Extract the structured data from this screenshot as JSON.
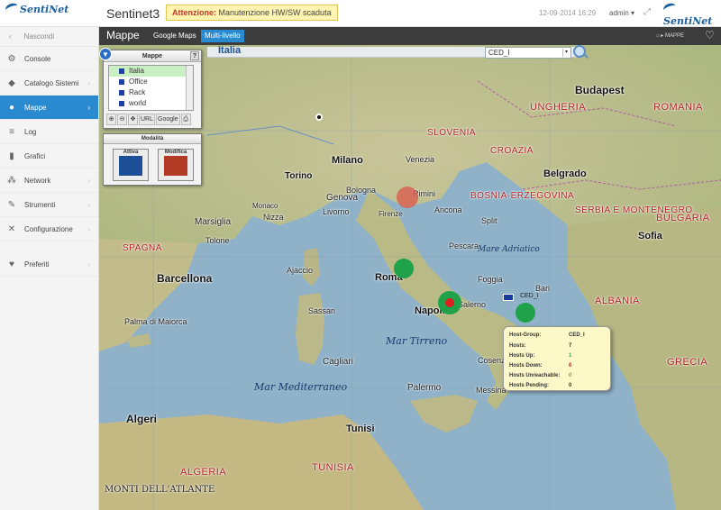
{
  "header": {
    "logo_text": "SentiNet",
    "app_title": "Sentinet3",
    "alert_prefix": "Attenzione:",
    "alert_text": "Manutenzione HW/SW scaduta",
    "datetime": "12-09-2014 16:29",
    "user": "admin",
    "user_caret": "▾",
    "expand_icon": "⤢"
  },
  "sidebar": {
    "hide_label": "Nascondi",
    "items": [
      {
        "label": "Console",
        "icon": "⚙",
        "chevron": ""
      },
      {
        "label": "Catalogo Sistemi",
        "icon": "◆",
        "chevron": "›"
      },
      {
        "label": "Mappe",
        "icon": "●",
        "chevron": "›"
      },
      {
        "label": "Log",
        "icon": "≡",
        "chevron": ""
      },
      {
        "label": "Grafici",
        "icon": "▮",
        "chevron": ""
      },
      {
        "label": "Network",
        "icon": "⁂",
        "chevron": "›"
      },
      {
        "label": "Strumenti",
        "icon": "✎",
        "chevron": "›"
      },
      {
        "label": "Configurazione",
        "icon": "✕",
        "chevron": "›"
      },
      {
        "label": "Preferiti",
        "icon": "♥",
        "chevron": "›"
      }
    ]
  },
  "content": {
    "title": "Mappe",
    "tabs": [
      "Google Maps",
      "Multi-livello"
    ],
    "breadcrumb": "⌂ ▸ MAPPE",
    "favorite_icon": "♡"
  },
  "map": {
    "name": "Italia",
    "select_value": "CED_I",
    "select_caret": "▾",
    "labels": [
      "Budapest",
      "UNGHERIA",
      "ROMANIA",
      "SLOVENIA",
      "CROAZIA",
      "Belgrado",
      "BOSNIA-ERZEGOVINA",
      "SERBIA E MONTENEGRO",
      "BULGARIA",
      "Sofia",
      "Milano",
      "Torino",
      "Genova",
      "Firenze",
      "Roma",
      "Napoli",
      "Bari",
      "Palermo",
      "Cagliari",
      "Barcellona",
      "SPAGNA",
      "Marsiglia",
      "Tolone",
      "Nizza",
      "Monaco",
      "Ajaccio",
      "Sassari",
      "Algeri",
      "ALGERIA",
      "Tunisi",
      "TUNISIA",
      "ALBANIA",
      "GRECIA",
      "Mar Tirreno",
      "Mar Mediterraneo",
      "Mare Adriatico",
      "Venezia",
      "Bologna",
      "Rimini",
      "Ancona",
      "Pescara",
      "Livorno",
      "Salerno",
      "Foggia",
      "Split",
      "Palma di Maiorca",
      "Cosenza",
      "Messina",
      "MONTI DELL'ATLANTE"
    ],
    "node_label": "CED_I"
  },
  "maps_panel": {
    "title": "Mappe",
    "help": "?",
    "items": [
      "Italia",
      "Office",
      "Rack",
      "world"
    ],
    "tools": [
      "⊕",
      "⊖",
      "✥",
      "URL",
      "Google",
      "⎙"
    ]
  },
  "modality": {
    "title": "Modalità",
    "activate": "Attiva",
    "edit": "Modifica"
  },
  "tooltip": {
    "rows": [
      {
        "label": "Host-Group:",
        "value": "CED_I",
        "color": "#333333"
      },
      {
        "label": "Hosts:",
        "value": "7",
        "color": "#333333"
      },
      {
        "label": "Hosts Up:",
        "value": "1",
        "color": "#2e9e3a"
      },
      {
        "label": "Hosts Down:",
        "value": "6",
        "color": "#e02020"
      },
      {
        "label": "Hosts Unreachable:",
        "value": "0",
        "color": "#e07a00"
      },
      {
        "label": "Hosts Pending:",
        "value": "0",
        "color": "#333333"
      }
    ]
  },
  "colors": {
    "accent": "#2a8ad0",
    "status_up": "#1fa24a",
    "status_down": "#e02020",
    "status_warn": "#d9574b"
  }
}
